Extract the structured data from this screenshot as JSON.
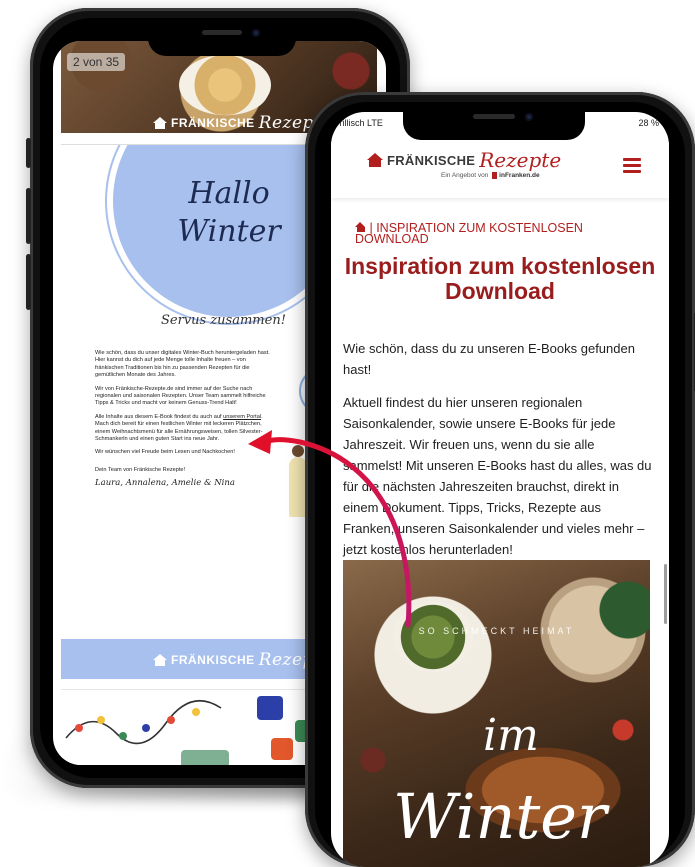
{
  "back_phone": {
    "page_counter": "2 von 35",
    "logo_word": "FRÄNKISCHE",
    "logo_script": "Rezepte",
    "ebook": {
      "hallo": "Hallo",
      "winter": "Winter",
      "greeting": "Servus zusammen!",
      "paragraphs": [
        "Wie schön, dass du unser digitales Winter-Buch heruntergeladen hast. Hier kannst du dich auf jede Menge tolle Inhalte freuen – von fränkischen Traditionen bis hin zu passenden Rezepten für die gemütlichen Monate des Jahres.",
        "Wir von Fränkische-Rezepte.de sind immer auf der Suche nach regionalen und saisonalen Rezepten. Unser Team sammelt hilfreiche Tipps & Tricks und macht vor keinem Genuss-Trend Halt!",
        "Alle Inhalte aus diesem E-Book findest du auch auf",
        "unserem Portal",
        ". Mach dich bereit für einen festlichen Winter mit leckeren Plätzchen, einem Weihnachtsmenü für alle Ernährungsweisen, tollen Silvester-Schmankerln und einen guten Start ins neue Jahr.",
        "Wir wünschen viel Freude beim Lesen und Nachkochen!"
      ],
      "sign_off": "Dein Team von Fränkische Rezepte!",
      "names": "Laura, Annalena, Amelie & Nina"
    }
  },
  "front_phone": {
    "status_left": "Drillisch  LTE",
    "status_right": "28 %",
    "brand_word": "FRÄNKISCHE",
    "brand_script": "Rezepte",
    "tagline_prefix": "Ein Angebot von",
    "tagline_brand": "inFranken.de",
    "breadcrumb": "| INSPIRATION ZUM KOSTENLOSEN DOWNLOAD",
    "title": "Inspiration zum kostenlosen Download",
    "intro_1": "Wie schön, dass du zu unseren E-Books gefunden hast!",
    "intro_2": "Aktuell findest du hier unseren regionalen Saisonkalender, sowie unsere E-Books für jede Jahreszeit. Wir freuen uns, wenn du sie alle sammelst! Mit unseren E-Books hast du alles, was du für die nächsten Jahreszeiten brauchst, direkt in einem Dokument. Tipps, Tricks, Rezepte aus Franken, unseren Saisonkalender und vieles mehr – jetzt kostenlos herunterladen!",
    "hero": {
      "brand_line": "SO SCHMECKT HEIMAT",
      "word_1": "im",
      "word_2": "Winter"
    }
  },
  "colors": {
    "brand_red": "#b21f1f",
    "title_red": "#9a1d1d",
    "ebook_blue": "#a8c0ee",
    "arrow_red": "#e0102a",
    "arrow_magenta": "#c2186b"
  }
}
